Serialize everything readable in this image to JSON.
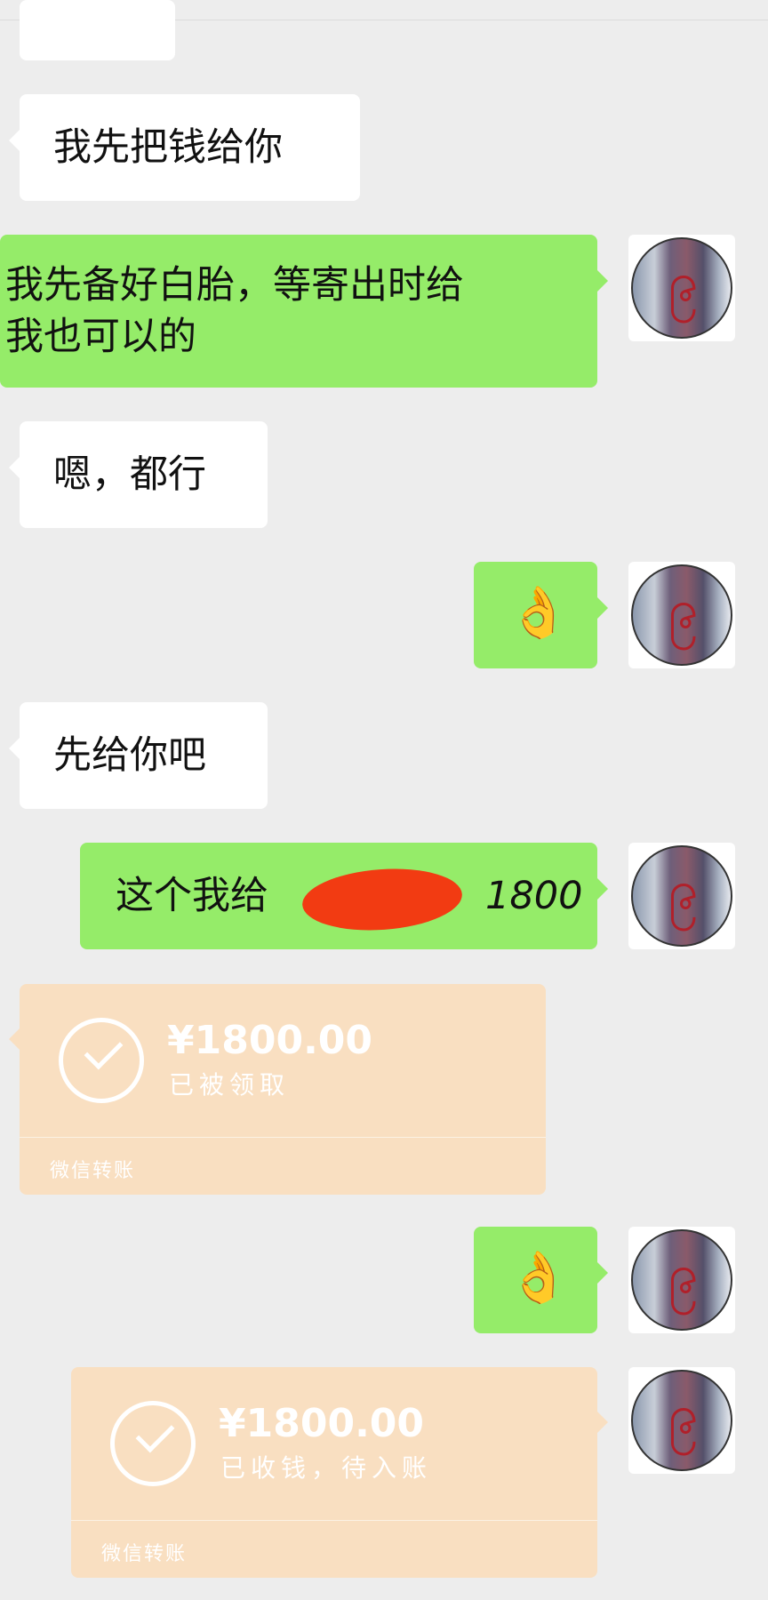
{
  "messages": {
    "m1": "我先把钱给你",
    "m2_line1": "我先备好白胎，等寄出时给",
    "m2_line2": "我也可以的",
    "m3": "嗯，都行",
    "m4_emoji": "👌",
    "m5": "先给你吧",
    "m6_text": "这个我给",
    "m6_amount": "1800",
    "m7_emoji": "👌"
  },
  "transfers": [
    {
      "amount": "¥1800.00",
      "status": "已被领取",
      "footer": "微信转账"
    },
    {
      "amount": "¥1800.00",
      "status": "已收钱，待入账",
      "footer": "微信转账"
    }
  ],
  "colors": {
    "background": "#ededed",
    "incoming_bubble": "#ffffff",
    "outgoing_bubble": "#95ec69",
    "transfer_card": "#f9dfc1",
    "redaction": "#f23b12"
  }
}
